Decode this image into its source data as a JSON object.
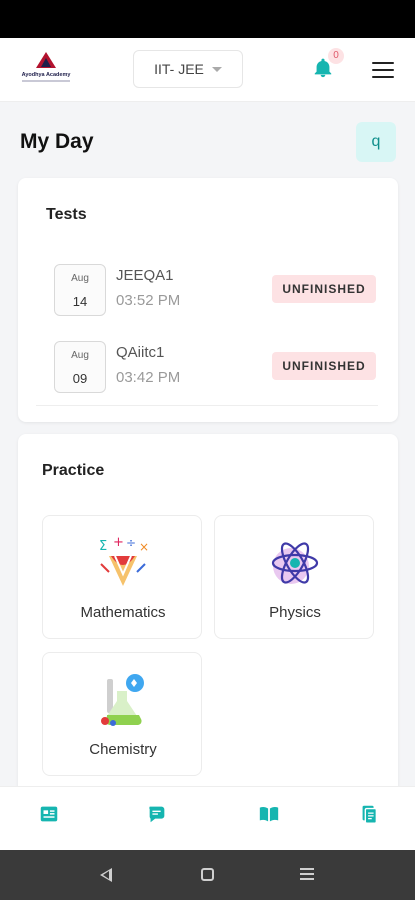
{
  "header": {
    "brand": "Ayodhya Academy",
    "exam_selector": "IIT- JEE",
    "notification_count": "0",
    "accent_color": "#16b5b0"
  },
  "page": {
    "title": "My Day",
    "avatar_letter": "q"
  },
  "tests": {
    "title": "Tests",
    "items": [
      {
        "month": "Aug",
        "day": "14",
        "name": "JEEQA1",
        "time": "03:52 PM",
        "status": "UNFINISHED"
      },
      {
        "month": "Aug",
        "day": "09",
        "name": "QAiitc1",
        "time": "03:42 PM",
        "status": "UNFINISHED"
      }
    ]
  },
  "practice": {
    "title": "Practice",
    "subjects": [
      {
        "label": "Mathematics",
        "icon": "math-symbols-icon"
      },
      {
        "label": "Physics",
        "icon": "atom-icon"
      },
      {
        "label": "Chemistry",
        "icon": "flask-icon"
      }
    ]
  },
  "bottom_nav": {
    "items": [
      {
        "icon": "news-feed-icon"
      },
      {
        "icon": "chat-icon"
      },
      {
        "icon": "book-icon"
      },
      {
        "icon": "documents-icon"
      }
    ]
  }
}
